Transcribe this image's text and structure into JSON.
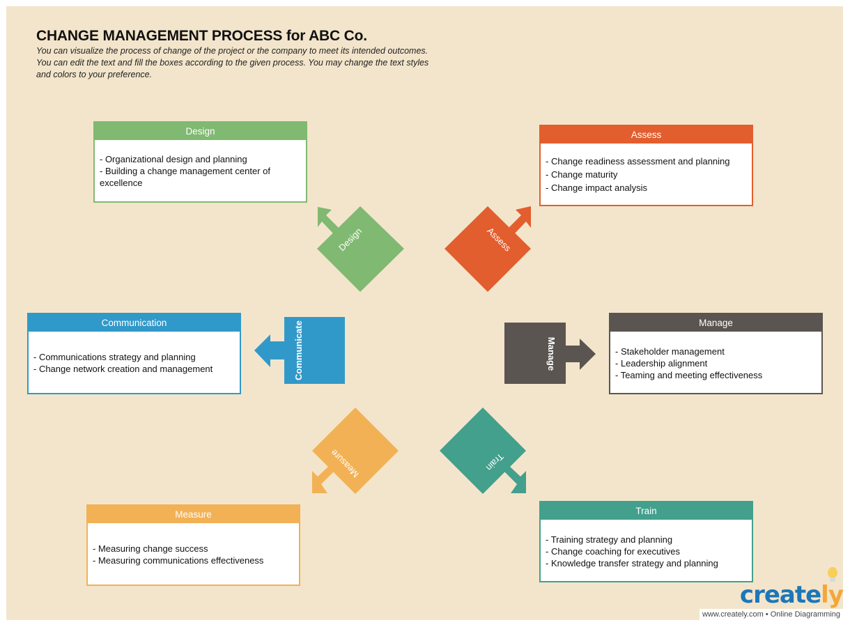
{
  "header": {
    "title": "CHANGE MANAGEMENT PROCESS for ABC Co.",
    "description": "You can visualize the process of change of the project or the company to meet its intended outcomes. You can edit the text and fill the boxes according to the given process. You may change the text styles and colors to your preference."
  },
  "colors": {
    "background": "#f3e5cb",
    "design": "#80b971",
    "assess": "#e25e2e",
    "communicate": "#3199c9",
    "manage": "#5a5550",
    "measure": "#f2b154",
    "train": "#42a08c"
  },
  "steps": {
    "design": {
      "shape_label": "Design",
      "card_title": "Design",
      "items": [
        "- Organizational design and planning",
        "- Building a change management center of excellence"
      ]
    },
    "assess": {
      "shape_label": "Assess",
      "card_title": "Assess",
      "items": [
        "- Change readiness assessment and planning",
        "- Change maturity",
        "- Change impact analysis"
      ]
    },
    "communicate": {
      "shape_label": "Communicate",
      "card_title": "Communication",
      "items": [
        "- Communications strategy and planning",
        "- Change network creation and management"
      ]
    },
    "manage": {
      "shape_label": "Manage",
      "card_title": "Manage",
      "items": [
        "- Stakeholder management",
        "- Leadership alignment",
        "- Teaming and meeting effectiveness"
      ]
    },
    "measure": {
      "shape_label": "Measure",
      "card_title": "Measure",
      "items": [
        "- Measuring change success",
        "- Measuring communications effectiveness"
      ]
    },
    "train": {
      "shape_label": "Train",
      "card_title": "Train",
      "items": [
        "- Training strategy and planning",
        "- Change coaching for executives",
        "- Knowledge transfer strategy and planning"
      ]
    }
  },
  "logo": {
    "brand_main": "create",
    "brand_tail": "ly",
    "tagline": "www.creately.com • Online Diagramming"
  }
}
